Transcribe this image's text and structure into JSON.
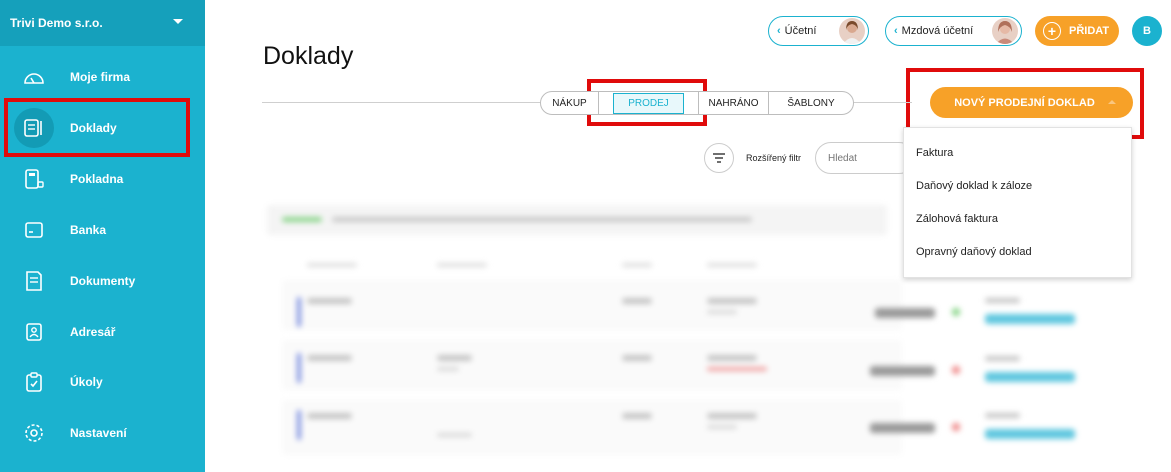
{
  "sidebar": {
    "company": "Trivi Demo s.r.o.",
    "items": [
      {
        "label": "Moje firma",
        "icon": "gauge-icon"
      },
      {
        "label": "Doklady",
        "icon": "receipt-icon"
      },
      {
        "label": "Pokladna",
        "icon": "cash-register-icon"
      },
      {
        "label": "Banka",
        "icon": "bank-card-icon"
      },
      {
        "label": "Dokumenty",
        "icon": "document-icon"
      },
      {
        "label": "Adresář",
        "icon": "address-book-icon"
      },
      {
        "label": "Úkoly",
        "icon": "task-clipboard-icon"
      },
      {
        "label": "Nastavení",
        "icon": "gear-icon"
      }
    ]
  },
  "header": {
    "title": "Doklady",
    "accountant_label": "Účetní",
    "payroll_label": "Mzdová účetní",
    "add_label": "PŘIDAT",
    "avatar_initial": "B"
  },
  "tabs": [
    "NÁKUP",
    "PRODEJ",
    "NAHRÁNO",
    "ŠABLONY"
  ],
  "new_button_label": "NOVÝ PRODEJNÍ DOKLAD",
  "filter": {
    "label": "Rozšířený filtr",
    "search_placeholder": "Hledat"
  },
  "dropdown": {
    "items": [
      "Faktura",
      "Daňový doklad k záloze",
      "Zálohová faktura",
      "Opravný daňový doklad"
    ]
  },
  "colors": {
    "sidebar": "#1bb2cf",
    "accent_orange": "#f7a128",
    "highlight_red": "#e00b0b"
  }
}
